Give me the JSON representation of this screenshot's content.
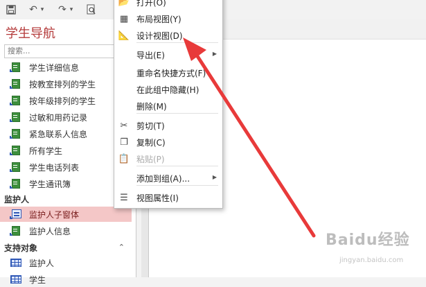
{
  "toolbar": {
    "icons": [
      "save-icon",
      "undo-icon",
      "redo-icon",
      "print-preview-icon"
    ],
    "undo_glyph": "↶",
    "redo_glyph": "↷",
    "dropdown_glyph": "▾"
  },
  "nav": {
    "title": "学生导航",
    "toggle_glyph": "«",
    "search_placeholder": "搜索...",
    "items": [
      {
        "label": "学生详细信息",
        "icon": "report"
      },
      {
        "label": "按教室排列的学生",
        "icon": "report"
      },
      {
        "label": "按年级排列的学生",
        "icon": "report"
      },
      {
        "label": "过敏和用药记录",
        "icon": "report"
      },
      {
        "label": "紧急联系人信息",
        "icon": "report"
      },
      {
        "label": "所有学生",
        "icon": "report"
      },
      {
        "label": "学生电话列表",
        "icon": "report"
      },
      {
        "label": "学生通讯簿",
        "icon": "report"
      }
    ],
    "section_guardian": "监护人",
    "guardian_items": [
      {
        "label": "监护人子窗体",
        "icon": "form",
        "selected": true
      },
      {
        "label": "监护人信息",
        "icon": "report"
      }
    ],
    "section_support": "支持对象",
    "support_chevron": "⌃",
    "support_items": [
      {
        "label": "监护人",
        "icon": "table"
      },
      {
        "label": "学生",
        "icon": "table"
      }
    ]
  },
  "context_menu": {
    "items": [
      {
        "label": "打开(O)",
        "icon": "open-icon",
        "glyph": "📂"
      },
      {
        "label": "布局视图(Y)",
        "icon": "layout-view-icon",
        "glyph": "▦"
      },
      {
        "label": "设计视图(D)",
        "icon": "design-view-icon",
        "glyph": "📐"
      },
      {
        "label": "导出(E)",
        "icon": "",
        "submenu": true
      },
      {
        "label": "重命名快捷方式(F)",
        "icon": ""
      },
      {
        "label": "在此组中隐藏(H)",
        "icon": ""
      },
      {
        "label": "删除(M)",
        "icon": ""
      },
      {
        "label": "剪切(T)",
        "icon": "scissors-icon",
        "glyph": "✂"
      },
      {
        "label": "复制(C)",
        "icon": "copy-icon",
        "glyph": "❐"
      },
      {
        "label": "粘贴(P)",
        "icon": "paste-icon",
        "glyph": "📋",
        "disabled": true
      },
      {
        "label": "添加到组(A)...",
        "icon": "",
        "submenu": true
      },
      {
        "label": "视图属性(I)",
        "icon": "properties-icon",
        "glyph": "☰"
      }
    ],
    "submenu_glyph": "▶"
  },
  "watermark": {
    "text": "Baidu经验",
    "subtext": "jingyan.baidu.com"
  },
  "colors": {
    "accent_arrow": "#e83a3a",
    "nav_title": "#b43a3a",
    "selected_row": "#f4c7c7"
  }
}
